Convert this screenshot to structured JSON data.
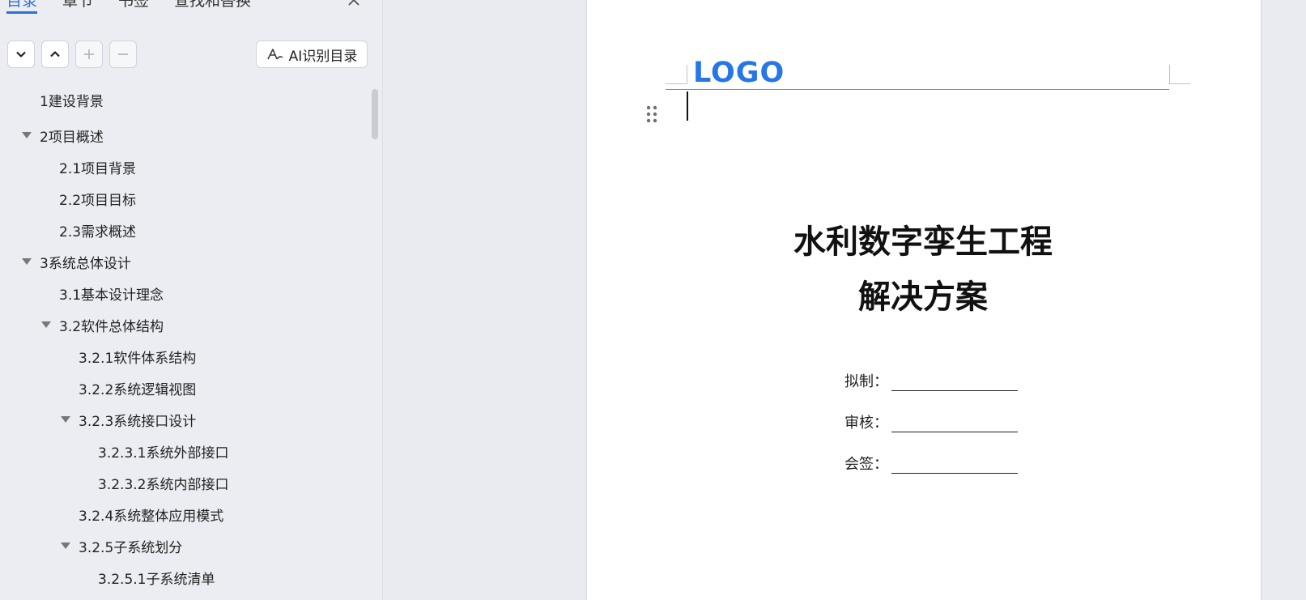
{
  "nav": {
    "tabs": [
      {
        "label": "目录",
        "active": true
      },
      {
        "label": "章节"
      },
      {
        "label": "书签"
      },
      {
        "label": "查找和替换"
      }
    ],
    "ai_button_label": "AI识别目录"
  },
  "toc": [
    {
      "label": "1建设背景",
      "level": 0,
      "expanded": null
    },
    {
      "label": "2项目概述",
      "level": 0,
      "expanded": true
    },
    {
      "label": "2.1项目背景",
      "level": 1,
      "expanded": null
    },
    {
      "label": "2.2项目目标",
      "level": 1,
      "expanded": null
    },
    {
      "label": "2.3需求概述",
      "level": 1,
      "expanded": null
    },
    {
      "label": "3系统总体设计",
      "level": 0,
      "expanded": true
    },
    {
      "label": "3.1基本设计理念",
      "level": 1,
      "expanded": null
    },
    {
      "label": "3.2软件总体结构",
      "level": 1,
      "expanded": true
    },
    {
      "label": "3.2.1软件体系结构",
      "level": 2,
      "expanded": null
    },
    {
      "label": "3.2.2系统逻辑视图",
      "level": 2,
      "expanded": null
    },
    {
      "label": "3.2.3系统接口设计",
      "level": 2,
      "expanded": true
    },
    {
      "label": "3.2.3.1系统外部接口",
      "level": 3,
      "expanded": null
    },
    {
      "label": "3.2.3.2系统内部接口",
      "level": 3,
      "expanded": null
    },
    {
      "label": "3.2.4系统整体应用模式",
      "level": 2,
      "expanded": null
    },
    {
      "label": "3.2.5子系统划分",
      "level": 2,
      "expanded": true
    },
    {
      "label": "3.2.5.1子系统清单",
      "level": 3,
      "expanded": null
    }
  ],
  "document": {
    "logo_text": "LOGO",
    "title_line1": "水利数字孪生工程",
    "title_line2": "解决方案",
    "sign_rows": [
      {
        "label": "拟制："
      },
      {
        "label": "审核："
      },
      {
        "label": "会签："
      }
    ]
  },
  "colors": {
    "accent": "#2f6fd6",
    "logo": "#2676e8",
    "pane_bg": "#ebedf2",
    "workspace_bg": "#e9ebf0"
  }
}
